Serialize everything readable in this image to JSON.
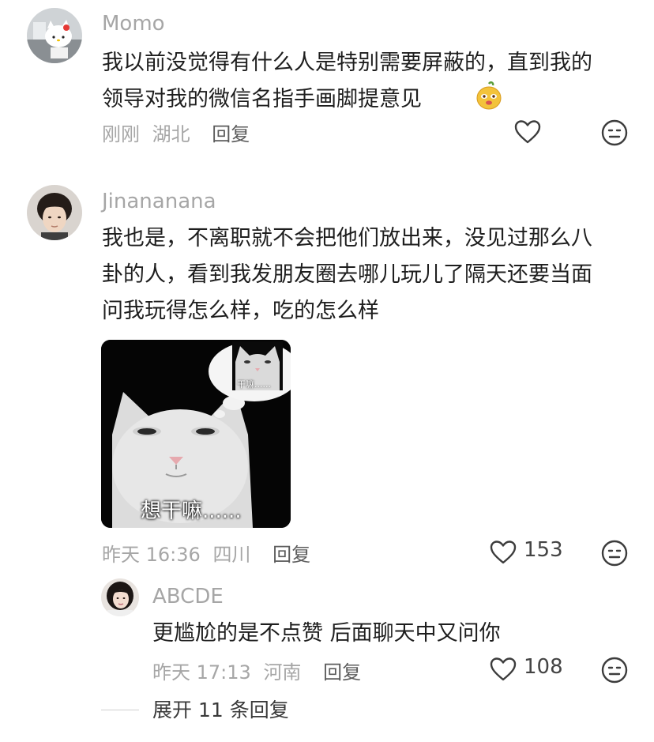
{
  "comments": [
    {
      "username": "Momo",
      "text": "我以前没觉得有什么人是特别需要屏蔽的，直到我的\n领导对我的微信名指手画脚提意见",
      "time": "刚刚",
      "location": "湖北",
      "reply_label": "回复",
      "avatar_icon": "hello-kitty-avatar"
    },
    {
      "username": "Jinananana",
      "text": "我也是，不离职就不会把他们放出来，没见过那么八\n卦的人，看到我发朋友圈去哪儿玩儿了隔天还要当面\n问我玩得怎么样，吃的怎么样",
      "meme_caption": "想干嘛......",
      "meme_thought_caption": "干嘛......",
      "time": "昨天 16:36",
      "location": "四川",
      "reply_label": "回复",
      "likes": "153"
    }
  ],
  "reply": {
    "username": "ABCDE",
    "text": "更尴尬的是不点赞 后面聊天中又问你",
    "time": "昨天 17:13",
    "location": "河南",
    "reply_label": "回复",
    "likes": "108"
  },
  "expand_label": "展开 11 条回复",
  "colors": {
    "username": "#a6a6a6",
    "text": "#1e1e1e",
    "meta": "#a6a6a6"
  }
}
